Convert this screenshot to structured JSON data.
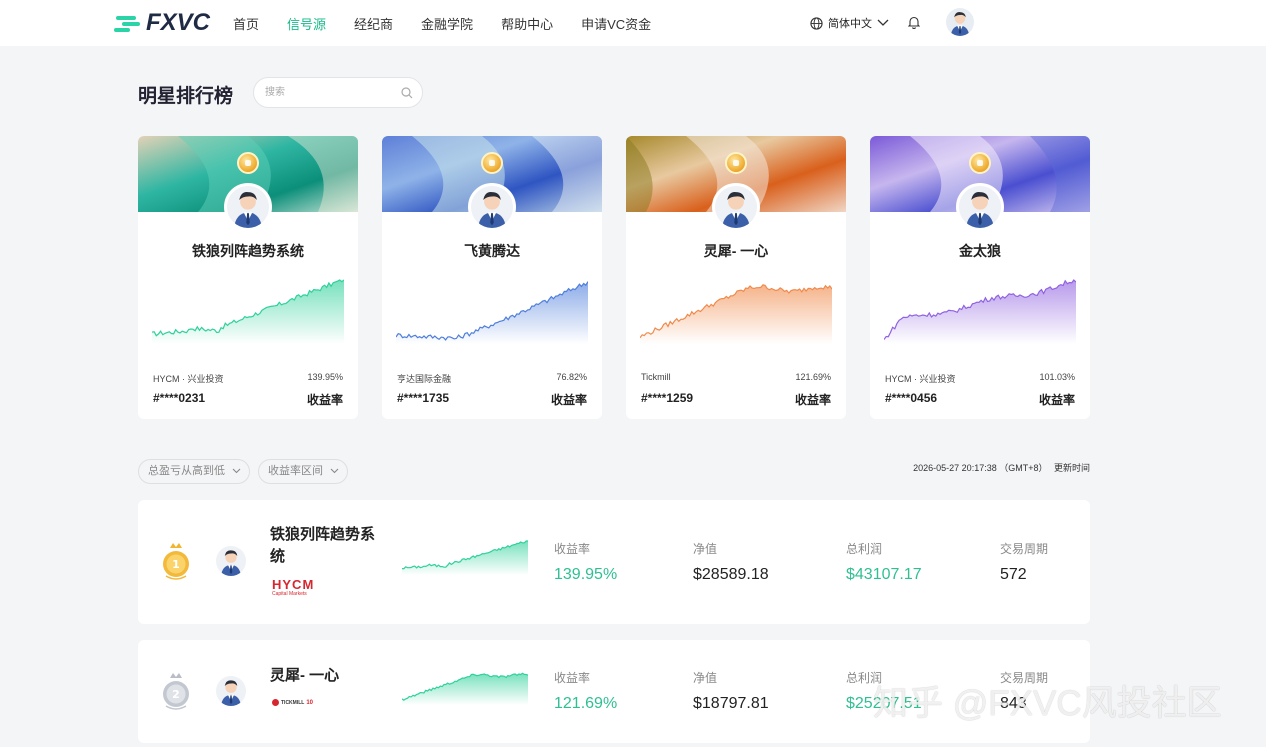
{
  "nav": {
    "logo": "FXVC",
    "items": [
      {
        "label": "首页",
        "active": false
      },
      {
        "label": "信号源",
        "active": true
      },
      {
        "label": "经纪商",
        "active": false
      },
      {
        "label": "金融学院",
        "active": false
      },
      {
        "label": "帮助中心",
        "active": false
      },
      {
        "label": "申请VC资金",
        "active": false
      }
    ],
    "language": "简体中文",
    "icons": [
      "globe-icon",
      "chevron-down-icon",
      "bell-icon",
      "avatar"
    ]
  },
  "header": {
    "title": "明星排行榜",
    "search_placeholder": "搜索"
  },
  "cards": [
    {
      "name": "铁狼列阵趋势系统",
      "broker": "HYCM · 兴业投资",
      "pct": "139.95%",
      "id": "#****0231",
      "rate_label": "收益率",
      "color": "#2fd19b"
    },
    {
      "name": "飞黄腾达",
      "broker": "亨达国际金融",
      "pct": "76.82%",
      "id": "#****1735",
      "rate_label": "收益率",
      "color": "#4f7fdc"
    },
    {
      "name": "灵犀- 一心",
      "broker": "Tickmill",
      "pct": "121.69%",
      "id": "#****1259",
      "rate_label": "收益率",
      "color": "#f08a4b"
    },
    {
      "name": "金太狼",
      "broker": "HYCM · 兴业投资",
      "pct": "101.03%",
      "id": "#****0456",
      "rate_label": "收益率",
      "color": "#9062e0"
    }
  ],
  "filters": {
    "sort": "总盈亏从高到低",
    "range": "收益率区间",
    "updated_time": "2026-05-27 20:17:38 （GMT+8）",
    "updated_label": "更新时间"
  },
  "rows": [
    {
      "rank": "1",
      "name": "铁狼列阵趋势系统",
      "broker_logo": "HYCM",
      "broker_sub": "Capital Markets",
      "labels": {
        "rate": "收益率",
        "nav": "净值",
        "profit": "总利润",
        "period": "交易周期"
      },
      "rate": "139.95%",
      "nav_value": "$28589.18",
      "profit": "$43107.17",
      "period": "572"
    },
    {
      "rank": "2",
      "name": "灵犀- 一心",
      "broker_logo": "TICKMILL",
      "broker_sub": "10",
      "labels": {
        "rate": "收益率",
        "nav": "净值",
        "profit": "总利润",
        "period": "交易周期"
      },
      "rate": "121.69%",
      "nav_value": "$18797.81",
      "profit": "$25207.51",
      "period": "843"
    }
  ],
  "watermark": "知乎 @FXVC风投社区"
}
